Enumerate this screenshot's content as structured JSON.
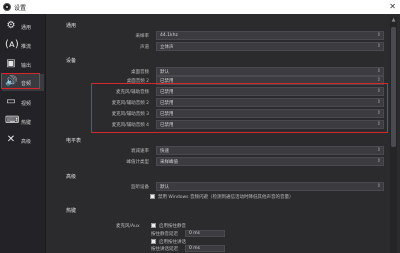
{
  "window": {
    "title": "设置",
    "close_glyph": "✕"
  },
  "sidebar": {
    "items": [
      {
        "label": "通用",
        "icon": "gear-icon"
      },
      {
        "label": "推流",
        "icon": "antenna-icon"
      },
      {
        "label": "输出",
        "icon": "output-icon"
      },
      {
        "label": "音频",
        "icon": "speaker-icon",
        "active": true
      },
      {
        "label": "视频",
        "icon": "monitor-icon"
      },
      {
        "label": "热键",
        "icon": "keyboard-icon"
      },
      {
        "label": "高级",
        "icon": "wrench-icon"
      }
    ]
  },
  "general": {
    "header": "通用",
    "sample_rate": {
      "label": "采样率",
      "value": "44.1khz"
    },
    "channels": {
      "label": "声道",
      "value": "立体声"
    }
  },
  "devices": {
    "header": "设备",
    "desktop1": {
      "label": "桌面音频",
      "value": "默认"
    },
    "desktop2": {
      "label": "桌面音频 2",
      "value": "已禁用"
    },
    "mic1": {
      "label": "麦克风/辅助音频",
      "value": "已禁用"
    },
    "mic2": {
      "label": "麦克风/辅助音频 2",
      "value": "已禁用"
    },
    "mic3": {
      "label": "麦克风/辅助音频 3",
      "value": "已禁用"
    },
    "mic4": {
      "label": "麦克风/辅助音频 4",
      "value": "已禁用"
    }
  },
  "meters": {
    "header": "电平表",
    "decay": {
      "label": "衰减速率",
      "value": "快速"
    },
    "peak": {
      "label": "峰值计类型",
      "value": "采样峰值"
    }
  },
  "advanced": {
    "header": "高级",
    "monitor": {
      "label": "监听设备",
      "value": "默认"
    },
    "ducking": "禁用 Windows 音频闪避（检测到通信活动时降低其他声音的音量）"
  },
  "hotkeys": {
    "header": "热键",
    "mic_label": "麦克风/Aux",
    "push_to_mute": "启用按住静音",
    "mute_delay_label": "按住静音延迟",
    "mute_delay": "0 ms",
    "push_to_talk": "启用按住讲话",
    "talk_delay_label": "按住讲话延迟",
    "talk_delay": "0 ms"
  },
  "dropdown_glyph": "⌃⌄"
}
